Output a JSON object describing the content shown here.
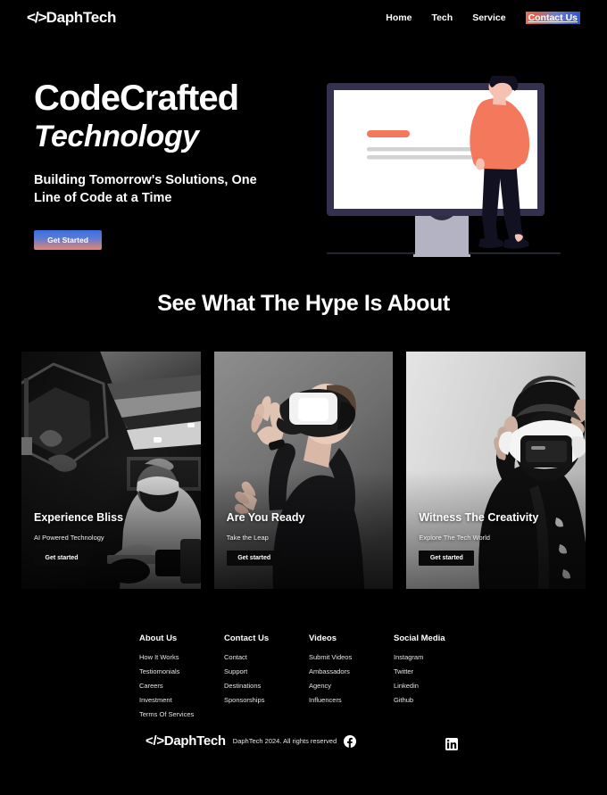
{
  "brand": {
    "name": "DaphTech",
    "logo_prefix": "</>",
    "accent_orange": "#e8856e",
    "accent_blue": "#3c6ee0"
  },
  "navbar": {
    "logo": "DaphTech",
    "links": [
      {
        "label": "Home",
        "active": false
      },
      {
        "label": "Tech",
        "active": false
      },
      {
        "label": "Service",
        "active": false
      },
      {
        "label": "Contact Us",
        "active": true
      }
    ]
  },
  "hero": {
    "title_line1": "CodeCrafted",
    "title_line2": "Technology",
    "subtitle": "Building Tomorrow's Solutions, One Line of Code at a Time",
    "cta_label": "Get Started",
    "illustration_name": "person-standing-beside-desktop-monitor"
  },
  "section": {
    "heading": "See What The Hype Is About"
  },
  "cards": [
    {
      "title": "Experience Bliss",
      "subtitle": "AI Powered Technology",
      "button_label": "Get started",
      "image_name": "vr-headset-user-in-dark-cockpit-bw-photo"
    },
    {
      "title": "Are You Ready",
      "subtitle": "Take the Leap",
      "button_label": "Get started",
      "image_name": "young-man-wearing-vr-headset-reaching-out-bw-photo"
    },
    {
      "title": "Witness The Creativity",
      "subtitle": "Explore The Tech World",
      "button_label": "Get started",
      "image_name": "person-in-black-hoodie-holding-vr-headset-bw-photo"
    }
  ],
  "footer": {
    "columns": [
      {
        "title": "About Us",
        "links": [
          "How It Works",
          "Testiomonials",
          "Careers",
          "Investment",
          "Terms Of Services"
        ]
      },
      {
        "title": "Contact Us",
        "links": [
          "Contact",
          "Support",
          "Destinations",
          "Sponsorships"
        ]
      },
      {
        "title": "Videos",
        "links": [
          "Submit Videos",
          "Ambassadors",
          "Agency",
          "Influencers"
        ]
      },
      {
        "title": "Social Media",
        "links": [
          "Instagram",
          "Twitter",
          "Linkedin",
          "Github"
        ]
      }
    ]
  },
  "bottombar": {
    "logo": "DaphTech",
    "copyright": "DaphTech 2024. All rights reserved",
    "social": [
      {
        "name": "facebook-icon"
      },
      {
        "name": "linkedin-icon"
      }
    ]
  }
}
